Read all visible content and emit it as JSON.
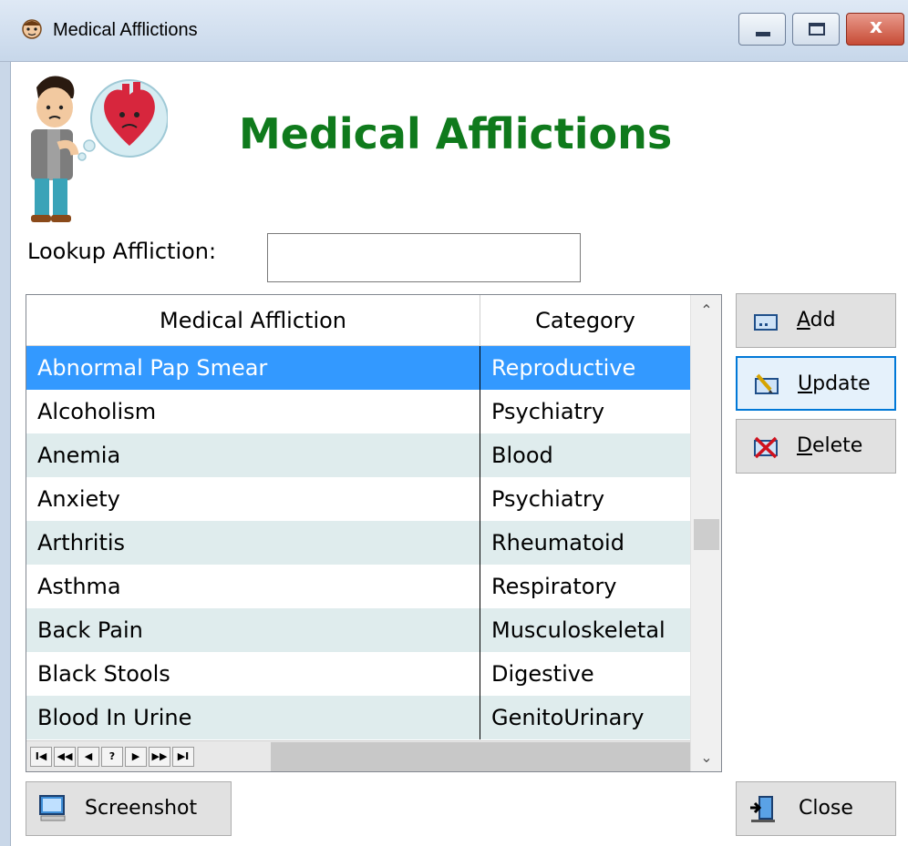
{
  "window": {
    "title": "Medical Afflictions",
    "close_glyph": "x"
  },
  "header": {
    "heading": "Medical Afflictions"
  },
  "lookup": {
    "label": "Lookup Affliction:",
    "value": ""
  },
  "grid": {
    "columns": [
      "Medical Affliction",
      "Category"
    ],
    "rows": [
      {
        "affliction": "Abnormal Pap Smear",
        "category": "Reproductive",
        "selected": true
      },
      {
        "affliction": "Alcoholism",
        "category": "Psychiatry"
      },
      {
        "affliction": "Anemia",
        "category": "Blood"
      },
      {
        "affliction": "Anxiety",
        "category": "Psychiatry"
      },
      {
        "affliction": "Arthritis",
        "category": "Rheumatoid"
      },
      {
        "affliction": "Asthma",
        "category": "Respiratory"
      },
      {
        "affliction": "Back Pain",
        "category": "Musculoskeletal"
      },
      {
        "affliction": "Black Stools",
        "category": "Digestive"
      },
      {
        "affliction": "Blood In Urine",
        "category": "GenitoUrinary"
      }
    ],
    "navigator": [
      "I◀",
      "◀◀",
      "◀",
      "?",
      "▶",
      "▶▶",
      "▶I"
    ]
  },
  "buttons": {
    "add": {
      "accel": "A",
      "rest": "dd"
    },
    "update": {
      "accel": "U",
      "rest": "pdate"
    },
    "delete": {
      "accel": "D",
      "rest": "elete"
    },
    "screenshot": "Screenshot",
    "close": "Close"
  },
  "icons": {
    "app": "doctor-face-icon",
    "logo": "sick-man-heart-icon",
    "add": "add-record-icon",
    "update": "edit-record-icon",
    "delete": "delete-record-icon",
    "screenshot": "monitor-icon",
    "close": "exit-door-icon"
  },
  "colors": {
    "heading": "#0f7a1c",
    "selection": "#3399ff",
    "alt_row": "#dfeced"
  }
}
